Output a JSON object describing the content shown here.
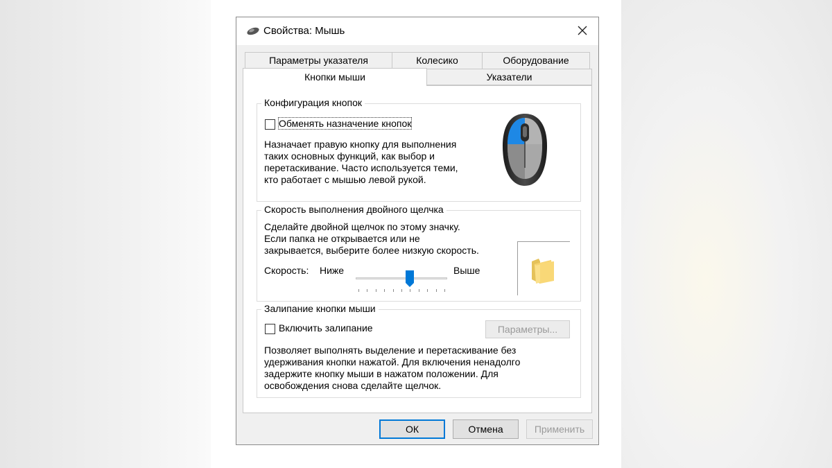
{
  "window": {
    "title": "Свойства: Мышь"
  },
  "tabs": [
    {
      "label": "Параметры указателя"
    },
    {
      "label": "Колесико"
    },
    {
      "label": "Оборудование"
    },
    {
      "label": "Кнопки мыши"
    },
    {
      "label": "Указатели"
    }
  ],
  "button_config": {
    "title": "Конфигурация кнопок",
    "swap_label": "Обменять назначение кнопок",
    "swap_checked": false,
    "description": [
      "Назначает правую кнопку для выполнения",
      "таких основных функций, как выбор и",
      "перетаскивание. Часто используется теми,",
      "кто работает с мышью левой рукой."
    ]
  },
  "double_click": {
    "title": "Скорость выполнения двойного щелчка",
    "description": [
      "Сделайте двойной щелчок по этому значку.",
      "Если папка не открывается или не",
      "закрывается, выберите более низкую скорость."
    ],
    "speed_label": "Скорость:",
    "low_label": "Ниже",
    "high_label": "Выше",
    "speed_value": 5,
    "speed_max": 10
  },
  "click_lock": {
    "title": "Залипание кнопки мыши",
    "enable_label": "Включить залипание",
    "enable_checked": false,
    "settings_button": "Параметры...",
    "description": [
      "Позволяет выполнять выделение и перетаскивание без",
      "удерживания кнопки нажатой. Для включения ненадолго",
      "задержите кнопку мыши в нажатом положении. Для",
      "освобождения снова сделайте щелчок."
    ]
  },
  "footer": {
    "ok": "ОК",
    "cancel": "Отмена",
    "apply": "Применить"
  },
  "colors": {
    "accent": "#0078d7",
    "mouse_highlight": "#1e88e5"
  }
}
